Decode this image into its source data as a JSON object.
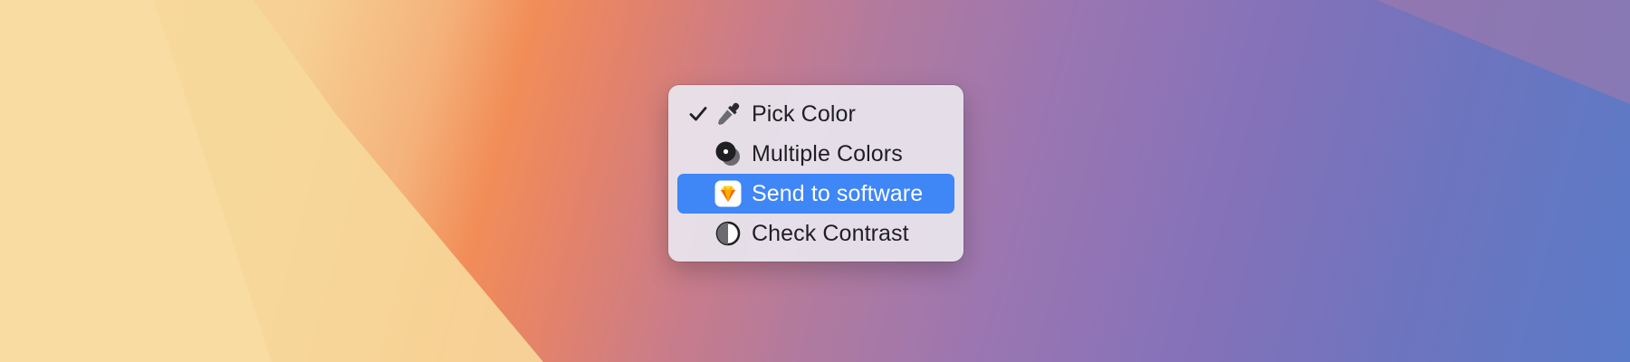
{
  "menu": {
    "items": [
      {
        "label": "Pick Color",
        "checked": true,
        "icon": "eyedropper-icon",
        "highlighted": false
      },
      {
        "label": "Multiple Colors",
        "checked": false,
        "icon": "multiple-colors-icon",
        "highlighted": false
      },
      {
        "label": "Send to software",
        "checked": false,
        "icon": "sketch-app-icon",
        "highlighted": true
      },
      {
        "label": "Check Contrast",
        "checked": false,
        "icon": "contrast-icon",
        "highlighted": false
      }
    ]
  },
  "colors": {
    "highlight": "#3f86f7",
    "menu_background": "#e8e4ec",
    "text": "#1f1f22"
  }
}
